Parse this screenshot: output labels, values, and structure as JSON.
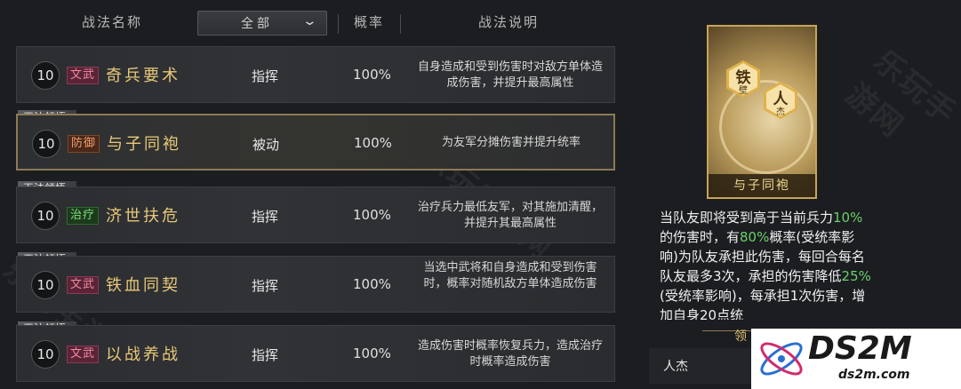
{
  "header": {
    "col_name": "战法名称",
    "filter_label": "全部",
    "col_rate": "概率",
    "col_desc": "战法说明"
  },
  "rows": [
    {
      "level": "10",
      "type": "文武",
      "name": "奇兵要术",
      "category": "指挥",
      "rate": "100%",
      "desc": "自身造成和受到伤害时对敌方单体造成伤害，并提升最高属性",
      "lock": ""
    },
    {
      "level": "10",
      "type": "防御",
      "name": "与子同袍",
      "category": "被动",
      "rate": "100%",
      "desc": "为友军分摊伤害并提升统率",
      "lock": "无法领悟"
    },
    {
      "level": "10",
      "type": "治疗",
      "name": "济世扶危",
      "category": "指挥",
      "rate": "100%",
      "desc": "治疗兵力最低友军，对其施加清醒，并提升其最高属性",
      "lock": "无法领悟"
    },
    {
      "level": "10",
      "type": "文武",
      "name": "铁血同契",
      "category": "指挥",
      "rate": "100%",
      "desc": "当选中武将和自身造成和受到伤害时，概率对随机敌方单体造成伤害",
      "lock": "无法领悟"
    },
    {
      "level": "10",
      "type": "文武",
      "name": "以战养战",
      "category": "指挥",
      "rate": "100%",
      "desc": "造成伤害时概率恢复兵力，造成治疗时概率造成伤害",
      "lock": "无法领悟"
    }
  ],
  "card": {
    "badge1_main": "铁",
    "badge1_sub": "壁",
    "badge2_main": "人",
    "badge2_sub": "杰",
    "title": "与子同袍"
  },
  "detail": {
    "p1": "当队友即将受到高于当前兵力",
    "g1": "10%",
    "p2": "的伤害时，有",
    "g2": "80%",
    "p3": "概率(受统率影响)为队友承担此伤害，每回合每名队友最多3次，承担的伤害降低",
    "g3": "25%",
    "p4": "(受统率影响)，每承担1次伤害，增加自身20点统"
  },
  "ling_label": "领",
  "who_label": "人杰",
  "watermark": "乐玩手游网",
  "logo": {
    "big": "DS2M",
    "small": "ds2m.com"
  }
}
